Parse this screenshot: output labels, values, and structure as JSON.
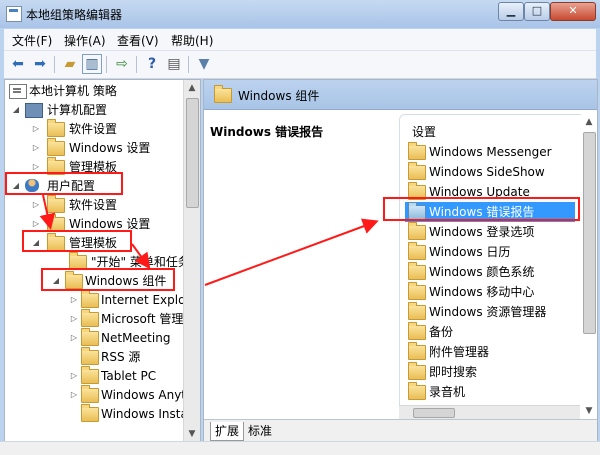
{
  "window": {
    "title": "本地组策略编辑器",
    "minimize_glyph": "▁",
    "maximize_glyph": "□",
    "close_glyph": "✕"
  },
  "menubar": {
    "items": [
      "文件(F)",
      "操作(A)",
      "查看(V)",
      "帮助(H)"
    ]
  },
  "toolbar": {
    "icons": [
      "back-arrow-icon",
      "forward-arrow-icon",
      "up-folder-icon",
      "show-hide-tree-icon",
      "export-list-icon",
      "help-icon",
      "properties-icon",
      "filter-icon"
    ]
  },
  "tree": {
    "root": "本地计算机 策略",
    "computer_config": "计算机配置",
    "computer_children": [
      "软件设置",
      "Windows 设置",
      "管理模板"
    ],
    "user_config": "用户配置",
    "user_children": [
      "软件设置",
      "Windows 设置",
      "管理模板"
    ],
    "start_menu": "\"开始\" 菜单和任务",
    "windows_components": "Windows 组件",
    "component_children": [
      "Internet Explor",
      "Microsoft 管理",
      "NetMeeting",
      "RSS 源",
      "Tablet PC",
      "Windows Anyti",
      "Windows Insta"
    ]
  },
  "detail": {
    "header": "Windows 组件",
    "selected_title": "Windows 错误报告",
    "list_header": "设置",
    "items": [
      "Windows Messenger",
      "Windows SideShow",
      "Windows Update",
      "Windows 错误报告",
      "Windows 登录选项",
      "Windows 日历",
      "Windows 颜色系统",
      "Windows 移动中心",
      "Windows 资源管理器",
      "备份",
      "附件管理器",
      "即时搜索",
      "录音机"
    ],
    "selected_index": 3
  },
  "tabs": {
    "extended": "扩展",
    "standard": "标准"
  },
  "colors": {
    "annotation": "#ff1a1a",
    "selection": "#3399ff"
  }
}
